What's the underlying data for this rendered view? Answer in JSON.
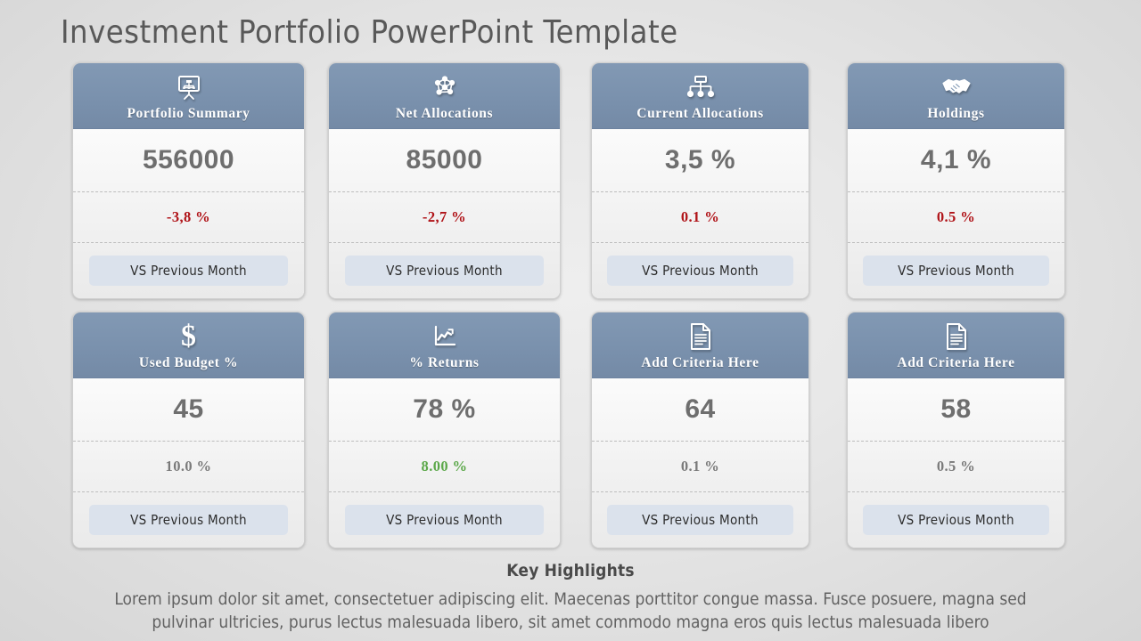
{
  "slide": {
    "title": "Investment Portfolio PowerPoint Template",
    "background_color": "#e2e2e2",
    "header_color": "#7a91ad",
    "button_color": "#dbe2ec",
    "positive_color": "#5ba849",
    "negative_color": "#b01318",
    "neutral_color": "#7a7a7a",
    "value_color": "#6e6e6e"
  },
  "cards": [
    {
      "icon": "presentation-board-icon",
      "title": "Portfolio Summary",
      "value": "556000",
      "delta": "-3,8 %",
      "delta_state": "negative",
      "button_label": "VS Previous Month"
    },
    {
      "icon": "network-nodes-icon",
      "title": "Net Allocations",
      "value": "85000",
      "delta": "-2,7 %",
      "delta_state": "negative",
      "button_label": "VS Previous Month"
    },
    {
      "icon": "org-chart-icon",
      "title": "Current Allocations",
      "value": "3,5 %",
      "delta": "0.1 %",
      "delta_state": "negative",
      "button_label": "VS Previous Month"
    },
    {
      "icon": "handshake-icon",
      "title": "Holdings",
      "value": "4,1 %",
      "delta": "0.5 %",
      "delta_state": "negative",
      "button_label": "VS Previous Month"
    },
    {
      "icon": "dollar-sign-icon",
      "title": "Used Budget %",
      "value": "45",
      "delta": "10.0 %",
      "delta_state": "neutral",
      "button_label": "VS Previous Month"
    },
    {
      "icon": "line-chart-icon",
      "title": "% Returns",
      "value": "78 %",
      "delta": "8.00 %",
      "delta_state": "positive",
      "button_label": "VS Previous Month"
    },
    {
      "icon": "document-icon",
      "title": "Add Criteria Here",
      "value": "64",
      "delta": "0.1 %",
      "delta_state": "neutral",
      "button_label": "VS Previous Month"
    },
    {
      "icon": "document-icon",
      "title": "Add Criteria Here",
      "value": "58",
      "delta": "0.5 %",
      "delta_state": "neutral",
      "button_label": "VS Previous Month"
    }
  ],
  "footer": {
    "title": "Key Highlights",
    "body": "Lorem ipsum dolor sit amet, consectetuer adipiscing elit. Maecenas porttitor congue massa. Fusce posuere, magna sed pulvinar ultricies, purus lectus malesuada libero, sit amet commodo magna eros quis lectus malesuada libero"
  }
}
